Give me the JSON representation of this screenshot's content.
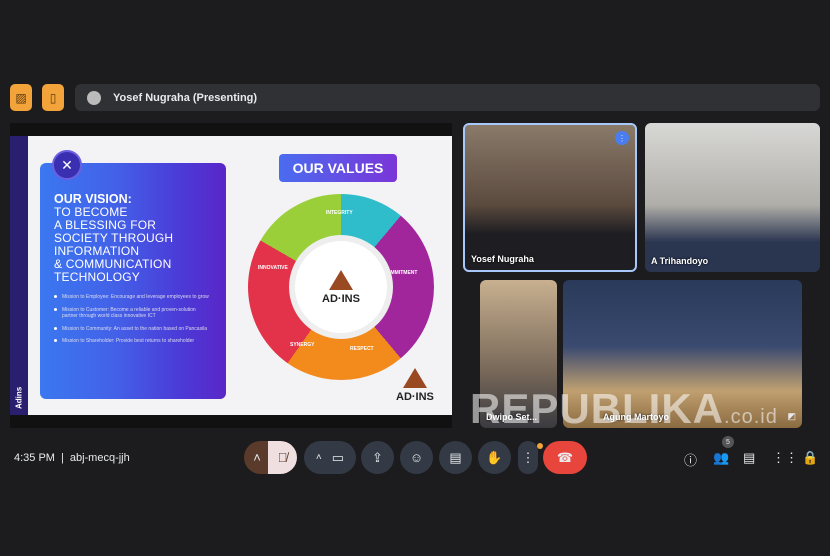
{
  "presenter_bar": {
    "text": "Yosef Nugraha (Presenting)"
  },
  "slide": {
    "side_label": "Adins",
    "vision_title": "OUR VISION:",
    "vision_text": [
      "TO BECOME",
      "A BLESSING FOR",
      "SOCIETY THROUGH",
      "INFORMATION",
      "& COMMUNICATION",
      "TECHNOLOGY"
    ],
    "missions": [
      "Mission to Employee: Encourage and leverage employees to grow",
      "Mission to Customer: Become a reliable and proven-solution partner through world class innovative ICT",
      "Mission to Community: An asset to the nation based on Pancasila",
      "Mission to Shareholder: Provide best returns to shareholder"
    ],
    "values_title": "OUR VALUES",
    "values": [
      "INTEGRITY",
      "COMMITMENT",
      "RESPECT",
      "SYNERGY",
      "INNOVATIVE"
    ],
    "logo_text": "AD·INS"
  },
  "participants": [
    {
      "name": "Yosef Nugraha"
    },
    {
      "name": "A Trihandoyo"
    },
    {
      "name": "Dwipo Set..."
    },
    {
      "name": "Agung Martoyo"
    }
  ],
  "footer": {
    "time": "4:35 PM",
    "separator": "|",
    "meeting_code": "abj-mecq-jjh",
    "people_count": "5"
  },
  "watermark": "REPUBLIKA",
  "watermark_suffix": ".co.id"
}
